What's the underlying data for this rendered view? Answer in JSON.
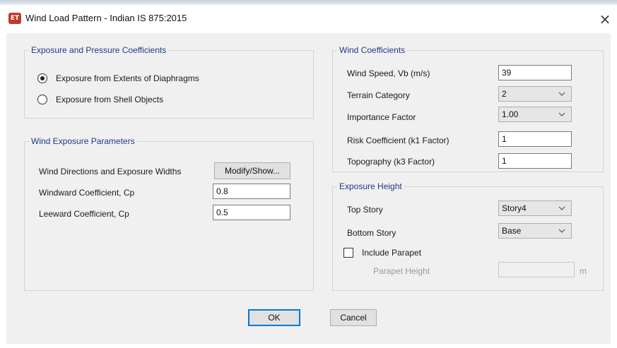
{
  "window": {
    "title": "Wind Load Pattern - Indian IS 875:2015",
    "icon_text": "ET",
    "close_symbol": "×"
  },
  "exposure_pressure": {
    "legend": "Exposure and Pressure Coefficients",
    "options": [
      {
        "label": "Exposure from Extents of Diaphragms",
        "selected": true
      },
      {
        "label": "Exposure from Shell Objects",
        "selected": false
      }
    ]
  },
  "wind_exposure": {
    "legend": "Wind Exposure Parameters",
    "directions_label": "Wind Directions and Exposure Widths",
    "modify_button": "Modify/Show...",
    "windward_label": "Windward Coefficient, Cp",
    "windward_value": "0.8",
    "leeward_label": "Leeward Coefficient, Cp",
    "leeward_value": "0.5"
  },
  "wind_coefficients": {
    "legend": "Wind Coefficients",
    "wind_speed_label": "Wind Speed, Vb (m/s)",
    "wind_speed_value": "39",
    "terrain_label": "Terrain Category",
    "terrain_value": "2",
    "importance_label": "Importance Factor",
    "importance_value": "1.00",
    "risk_label": "Risk Coefficient (k1 Factor)",
    "risk_value": "1",
    "topography_label": "Topography (k3 Factor)",
    "topography_value": "1"
  },
  "exposure_height": {
    "legend": "Exposure Height",
    "top_story_label": "Top Story",
    "top_story_value": "Story4",
    "bottom_story_label": "Bottom Story",
    "bottom_story_value": "Base",
    "include_parapet_label": "Include Parapet",
    "include_parapet_checked": false,
    "parapet_height_label": "Parapet Height",
    "parapet_height_value": "",
    "parapet_unit": "m"
  },
  "buttons": {
    "ok": "OK",
    "cancel": "Cancel"
  },
  "icons": {
    "close": "close-icon",
    "dropdown": "chevron-down-icon",
    "app": "etabs-app-icon"
  }
}
